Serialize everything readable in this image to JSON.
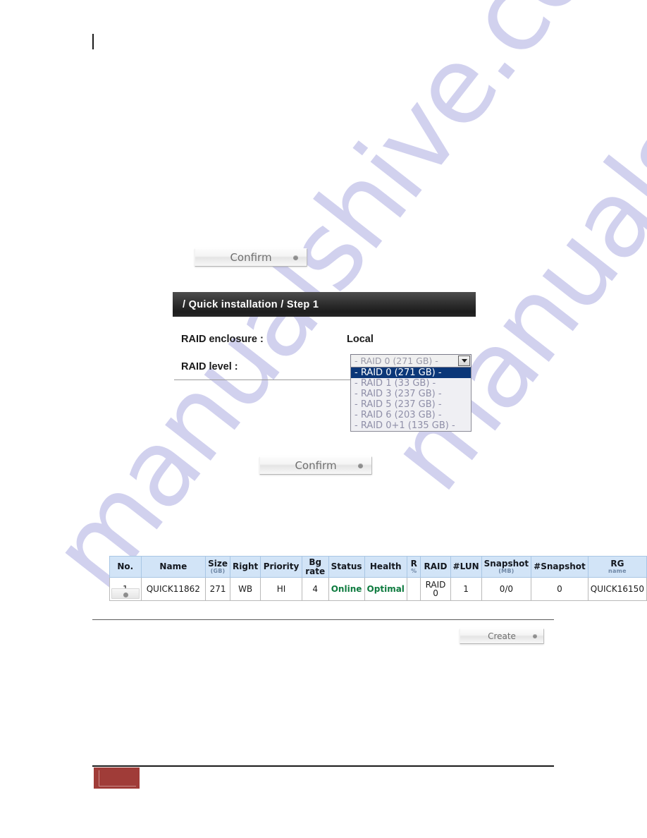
{
  "document": {
    "watermark": "manualshive.com",
    "top_mark": "|"
  },
  "buttons": {
    "confirm_top": "Confirm",
    "confirm_mid": "Confirm",
    "create": "Create"
  },
  "panel": {
    "title": "/ Quick installation / Step 1",
    "fields": [
      {
        "label": "RAID enclosure :",
        "value": "Local"
      },
      {
        "label": "RAID level :",
        "value": ""
      }
    ]
  },
  "raid_select": {
    "selected_value": "- RAID 0 (271 GB) -",
    "expanded": true,
    "options": [
      "- RAID 0 (271 GB) -",
      "- RAID 1 (33 GB) -",
      "- RAID 3 (237 GB) -",
      "- RAID 5 (237 GB) -",
      "- RAID 6 (203 GB) -",
      "- RAID 0+1 (135 GB) -"
    ],
    "selected_index": 0
  },
  "rg_table": {
    "headers": [
      {
        "main": "No.",
        "sub": ""
      },
      {
        "main": "Name",
        "sub": ""
      },
      {
        "main": "Size",
        "sub": "(GB)"
      },
      {
        "main": "Right",
        "sub": ""
      },
      {
        "main": "Priority",
        "sub": ""
      },
      {
        "main": "Bg rate",
        "sub": ""
      },
      {
        "main": "Status",
        "sub": ""
      },
      {
        "main": "Health",
        "sub": ""
      },
      {
        "main": "R",
        "sub": "%"
      },
      {
        "main": "RAID",
        "sub": ""
      },
      {
        "main": "#LUN",
        "sub": ""
      },
      {
        "main": "Snapshot",
        "sub": "(MB)"
      },
      {
        "main": "#Snapshot",
        "sub": ""
      },
      {
        "main": "RG",
        "sub": "name"
      }
    ],
    "rows": [
      {
        "no": "1",
        "name": "QUICK11862",
        "size": "271",
        "right": "WB",
        "priority": "HI",
        "bg_rate": "4",
        "status": "Online",
        "health": "Optimal",
        "r_percent": "",
        "raid": "RAID 0",
        "lun": "1",
        "snapshot": "0/0",
        "num_snapshot": "0",
        "rg_name": "QUICK16150"
      }
    ]
  },
  "colors": {
    "panel_header_bg": "#2a2a2a",
    "table_header_bg": "#d2e4f7",
    "status_ok": "#0e7b3f",
    "select_highlight": "#0b3778",
    "footer_box": "#a03c38",
    "watermark": "#c9c9ec"
  }
}
